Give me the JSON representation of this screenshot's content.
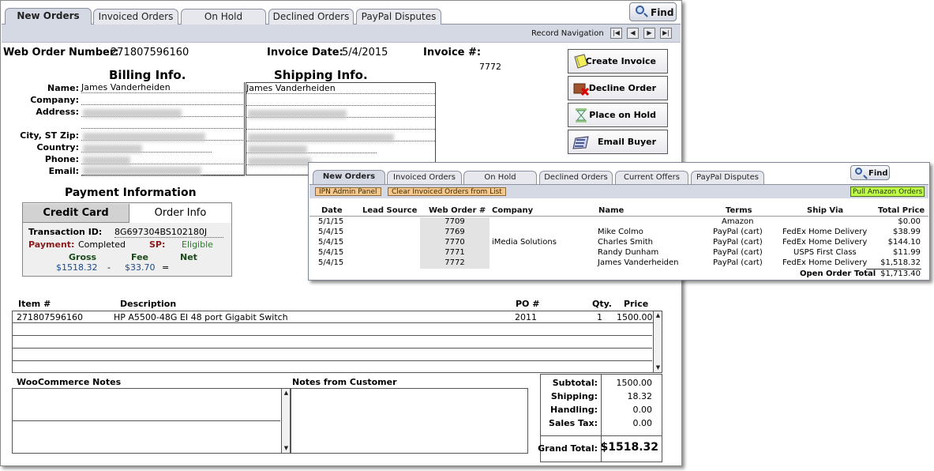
{
  "main": {
    "tabs": [
      "New Orders",
      "Invoiced Orders",
      "On Hold",
      "Declined Orders",
      "PayPal Disputes"
    ],
    "find_label": "Find",
    "record_nav_label": "Record Navigation",
    "web_order_label": "Web Order Number:",
    "web_order_number": "271807596160",
    "invoice_date_label": "Invoice Date:",
    "invoice_date": "5/4/2015",
    "invoice_num_label": "Invoice #:",
    "invoice_num": "7772",
    "billing_header": "Billing Info.",
    "shipping_header": "Shipping Info.",
    "field_labels": [
      "Name:",
      "Company:",
      "Address:",
      "City, ST Zip:",
      "Country:",
      "Phone:",
      "Email:"
    ],
    "billing_name": "James Vanderheiden",
    "shipping_name": "James Vanderheiden",
    "actions": [
      "Create Invoice",
      "Decline Order",
      "Place on Hold",
      "Email Buyer"
    ],
    "payment_header": "Payment Information",
    "pay_tabs": [
      "Credit Card",
      "Order Info"
    ],
    "transaction_label": "Transaction ID:",
    "transaction_id": "8G697304BS102180J",
    "payment_label": "Payment:",
    "payment_status": "Completed",
    "sp_label": "SP:",
    "sp_status": "Eligible",
    "gross_label": "Gross",
    "fee_label": "Fee",
    "net_label": "Net",
    "gross": "$1518.32",
    "minus": "-",
    "fee": "$33.70",
    "equals": "=",
    "items_cols": [
      "Item #",
      "Description",
      "PO #",
      "Qty.",
      "Price"
    ],
    "item": {
      "num": "271807596160",
      "desc": "HP A5500-48G EI 48 port Gigabit Switch",
      "po": "2011",
      "qty": "1",
      "price": "1500.00"
    },
    "woo_notes_label": "WooCommerce Notes",
    "customer_notes_label": "Notes from Customer",
    "totals": {
      "subtotal_label": "Subtotal:",
      "subtotal": "1500.00",
      "shipping_label": "Shipping:",
      "shipping": "18.32",
      "handling_label": "Handling:",
      "handling": "0.00",
      "tax_label": "Sales Tax:",
      "tax": "0.00",
      "grand_label": "Grand Total:",
      "grand": "$1518.32"
    }
  },
  "popup": {
    "tabs": [
      "New Orders",
      "Invoiced Orders",
      "On Hold",
      "Declined Orders",
      "Current Offers",
      "PayPal Disputes"
    ],
    "find_label": "Find",
    "ipn_btn": "IPN Admin Panel",
    "clear_btn": "Clear Invoiced Orders from List",
    "amazon_btn": "Pull Amazon Orders",
    "cols": [
      "Date",
      "Lead Source",
      "Web Order #",
      "Company",
      "Name",
      "Terms",
      "Ship Via",
      "Total Price"
    ],
    "rows": [
      {
        "date": "5/1/15",
        "web": "7709",
        "company": "",
        "name": "",
        "terms": "Amazon",
        "ship": "",
        "total": "$0.00"
      },
      {
        "date": "5/4/15",
        "web": "7769",
        "company": "",
        "name": "Mike Colmo",
        "terms": "PayPal (cart)",
        "ship": "FedEx Home Delivery",
        "total": "$38.99"
      },
      {
        "date": "5/4/15",
        "web": "7770",
        "company": "iMedia Solutions",
        "name": "Charles Smith",
        "terms": "PayPal (cart)",
        "ship": "FedEx Home Delivery",
        "total": "$144.10"
      },
      {
        "date": "5/4/15",
        "web": "7771",
        "company": "",
        "name": "Randy Dunham",
        "terms": "PayPal (cart)",
        "ship": "USPS First Class",
        "total": "$11.99"
      },
      {
        "date": "5/4/15",
        "web": "7772",
        "company": "",
        "name": "James Vanderheiden",
        "terms": "PayPal (cart)",
        "ship": "FedEx Home Delivery",
        "total": "$1,518.32"
      }
    ],
    "open_total_label": "Open Order Total",
    "open_total": "$1,713.40"
  }
}
